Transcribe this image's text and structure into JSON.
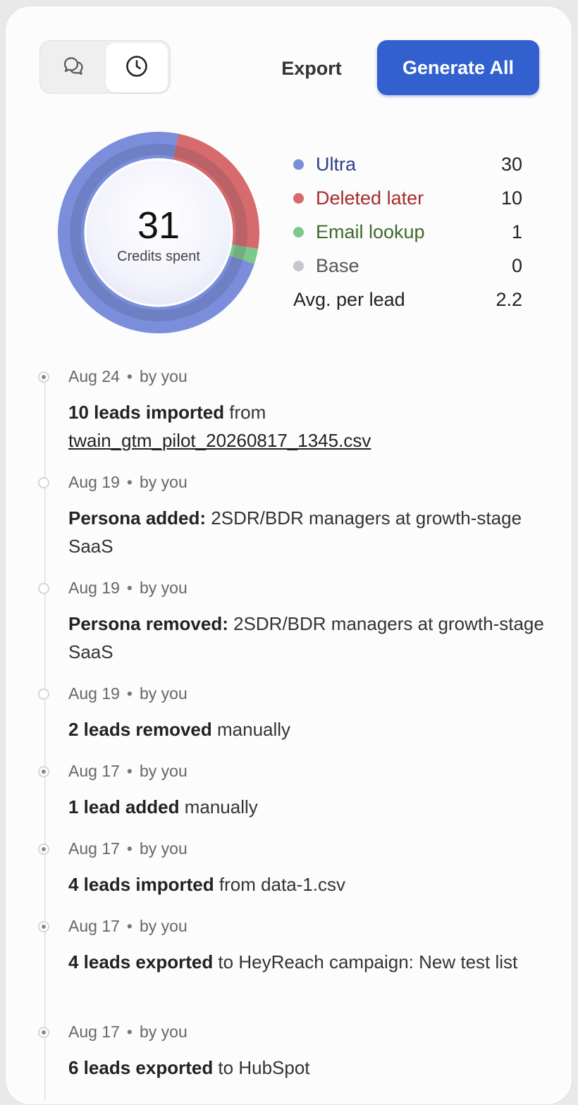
{
  "toolbar": {
    "view_comments_icon": "chat-bubbles-icon",
    "view_history_icon": "clock-icon",
    "export_label": "Export",
    "generate_label": "Generate All"
  },
  "credits": {
    "total": "31",
    "total_label": "Credits spent",
    "legend": [
      {
        "name": "Ultra",
        "value": "30",
        "color": "#7b8edb",
        "text_color": "#2c3f8a"
      },
      {
        "name": "Deleted later",
        "value": "10",
        "color": "#d76a6c",
        "text_color": "#a52c2e"
      },
      {
        "name": "Email lookup",
        "value": "1",
        "color": "#7cc98a",
        "text_color": "#3e6a2e"
      },
      {
        "name": "Base",
        "value": "0",
        "color": "#c4c6d0",
        "text_color": "#555555"
      }
    ],
    "avg_label": "Avg. per lead",
    "avg_value": "2.2"
  },
  "chart_data": {
    "type": "pie",
    "title": "",
    "categories": [
      "Ultra",
      "Deleted later",
      "Email lookup",
      "Base"
    ],
    "values": [
      30,
      10,
      1,
      0
    ],
    "colors": [
      "#7b8edb",
      "#d76a6c",
      "#7cc98a",
      "#c4c6d0"
    ]
  },
  "timeline": [
    {
      "date": "Aug 24",
      "by": "by you",
      "marker": "filled",
      "bold": "10 leads imported",
      "rest": " from ",
      "link": "twain_gtm_pilot_20260817_1345.csv"
    },
    {
      "date": "Aug 19",
      "by": "by you",
      "marker": "empty",
      "bold": "Persona added:",
      "rest": " 2SDR/BDR managers at growth-stage SaaS",
      "link": ""
    },
    {
      "date": "Aug 19",
      "by": "by you",
      "marker": "empty",
      "bold": "Persona removed:",
      "rest": " 2SDR/BDR managers at growth-stage SaaS",
      "link": ""
    },
    {
      "date": "Aug 19",
      "by": "by you",
      "marker": "empty",
      "bold": "2 leads removed",
      "rest": " manually",
      "link": ""
    },
    {
      "date": "Aug 17",
      "by": "by you",
      "marker": "filled",
      "bold": "1 lead added",
      "rest": " manually",
      "link": ""
    },
    {
      "date": "Aug 17",
      "by": "by you",
      "marker": "filled",
      "bold": "4 leads imported",
      "rest": " from data-1.csv",
      "link": ""
    },
    {
      "date": "Aug 17",
      "by": "by you",
      "marker": "filled",
      "bold": "4 leads exported",
      "rest": " to HeyReach campaign: New test list",
      "link": ""
    },
    {
      "date": "Aug 17",
      "by": "by you",
      "marker": "filled",
      "bold": "6 leads exported",
      "rest": " to HubSpot",
      "link": ""
    }
  ]
}
